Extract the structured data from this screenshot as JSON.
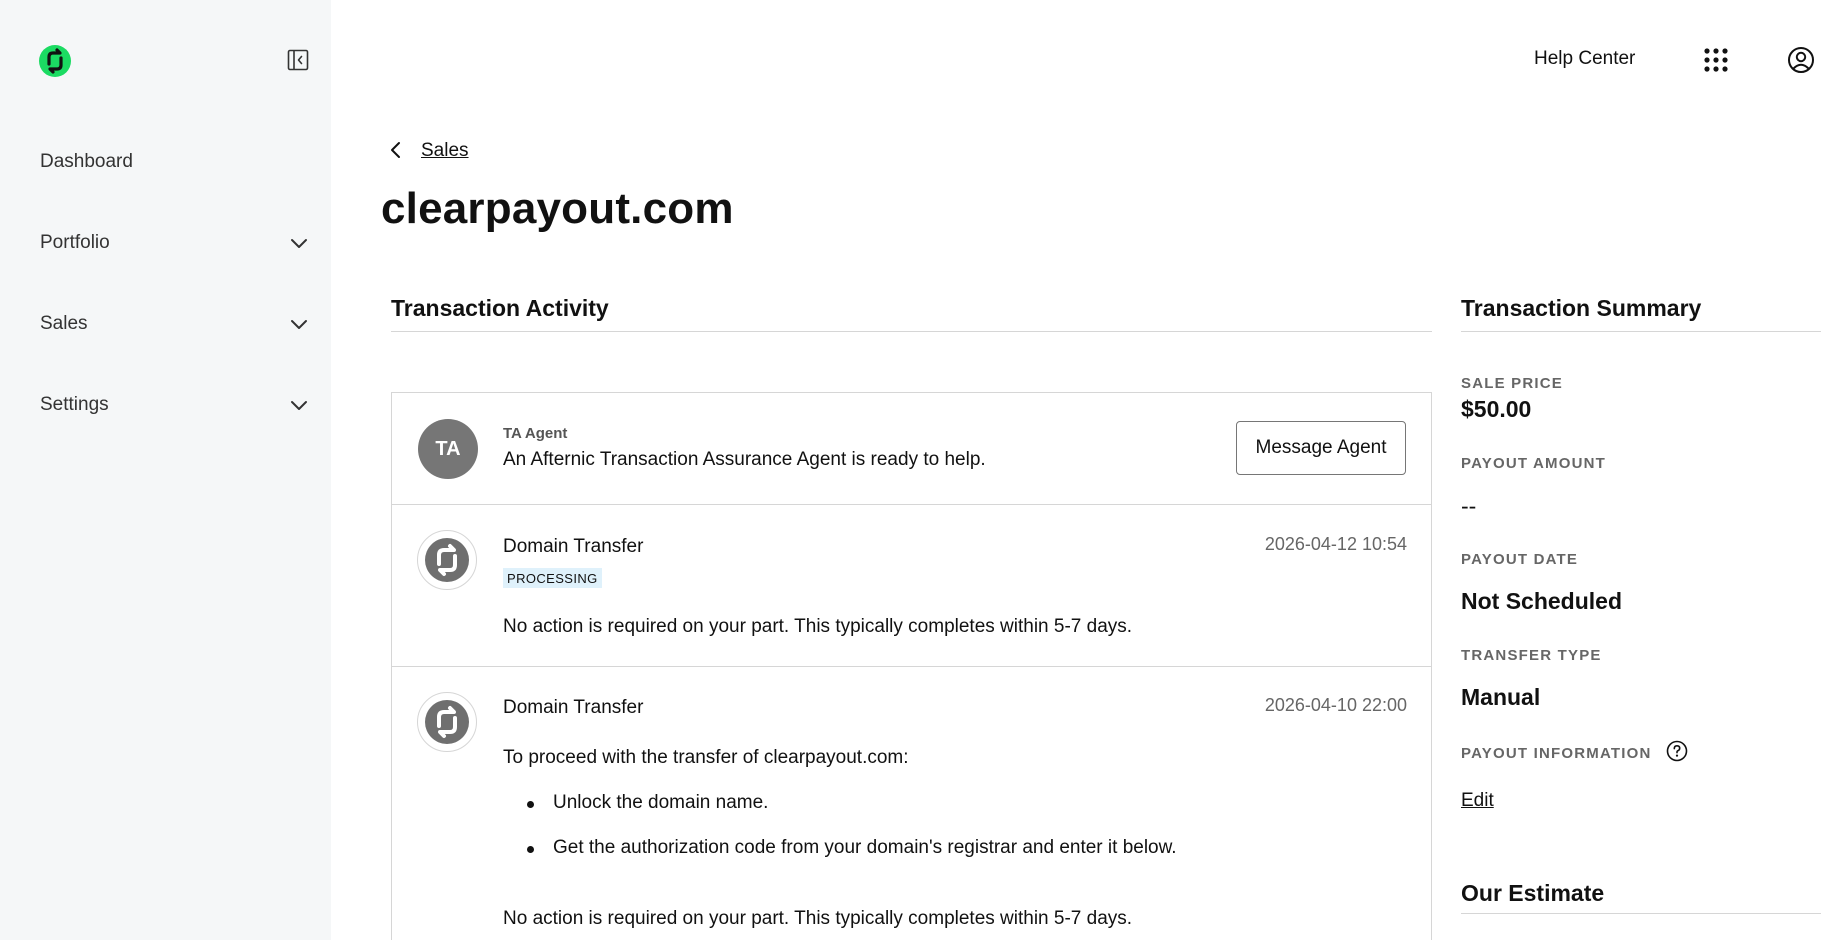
{
  "colors": {
    "brand_green": "#1bdb62",
    "sidebar_bg": "#f5f7f8",
    "badge_bg": "#dff1fb"
  },
  "sidebar": {
    "logo_icon": "afternic-logo-icon",
    "collapse_icon": "sidebar-collapse-icon",
    "items": [
      {
        "label": "Dashboard",
        "expandable": false
      },
      {
        "label": "Portfolio",
        "expandable": true
      },
      {
        "label": "Sales",
        "expandable": true
      },
      {
        "label": "Settings",
        "expandable": true
      }
    ]
  },
  "topbar": {
    "help_center": "Help Center",
    "apps_icon": "apps-grid-icon",
    "account_icon": "account-icon"
  },
  "breadcrumb": {
    "link": "Sales"
  },
  "page": {
    "title": "clearpayout.com"
  },
  "activity": {
    "heading": "Transaction Activity",
    "agent": {
      "initials": "TA",
      "label": "TA Agent",
      "text": "An Afternic Transaction Assurance Agent is ready to help.",
      "button": "Message Agent"
    },
    "events": [
      {
        "title": "Domain Transfer",
        "timestamp": "2026-04-12 10:54",
        "badge": "PROCESSING",
        "text": "No action is required on your part. This typically completes within 5-7 days."
      },
      {
        "title": "Domain Transfer",
        "timestamp": "2026-04-10 22:00",
        "intro": "To proceed with the transfer of clearpayout.com:",
        "bullets": [
          "Unlock the domain name.",
          "Get the authorization code from your domain's registrar and enter it below."
        ],
        "text": "No action is required on your part. This typically completes within 5-7 days."
      }
    ]
  },
  "summary": {
    "heading": "Transaction Summary",
    "sale_price_label": "SALE PRICE",
    "sale_price": "$50.00",
    "payout_amount_label": "PAYOUT AMOUNT",
    "payout_amount": "--",
    "payout_date_label": "PAYOUT DATE",
    "payout_date": "Not Scheduled",
    "transfer_type_label": "TRANSFER TYPE",
    "transfer_type": "Manual",
    "payout_info_label": "PAYOUT INFORMATION",
    "payout_info_edit": "Edit"
  },
  "estimate": {
    "heading": "Our Estimate"
  }
}
